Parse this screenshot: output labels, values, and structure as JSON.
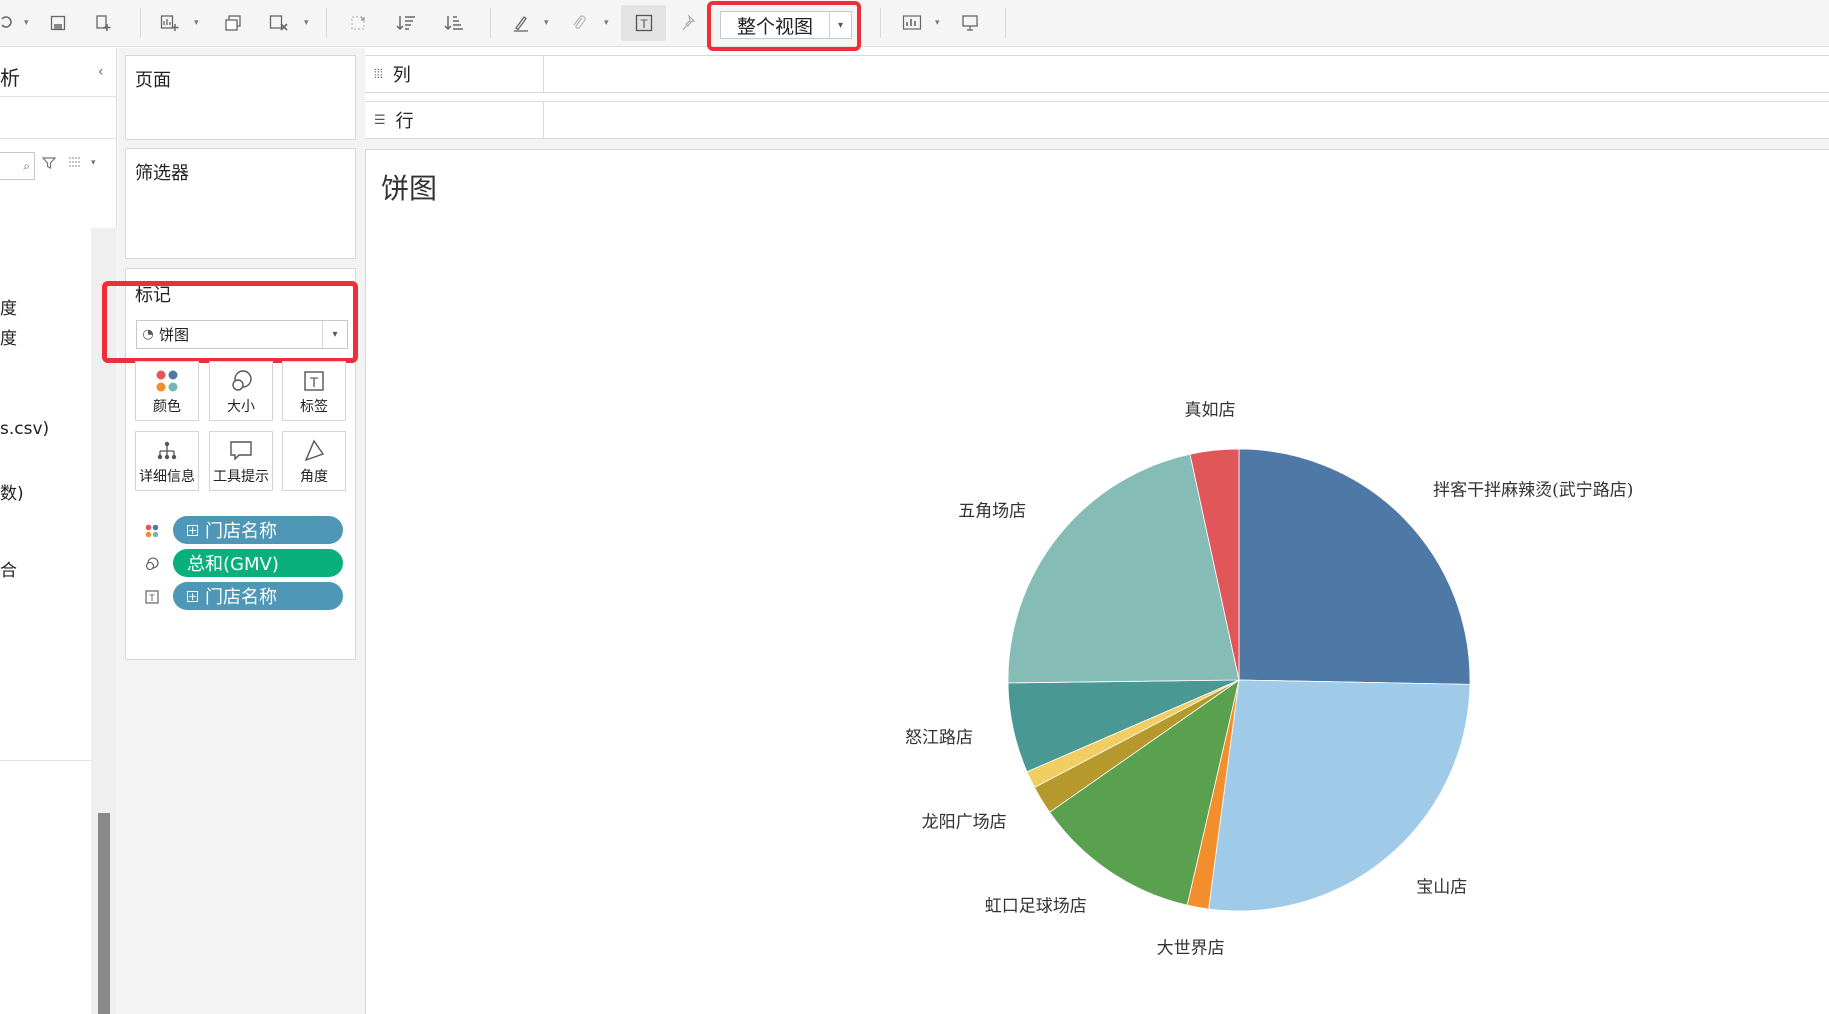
{
  "toolbar": {
    "fit_select_value": "整个视图",
    "icons": [
      "redo-icon",
      "save-icon",
      "new-datasource-icon",
      "new-worksheet-icon",
      "duplicate-sheet-icon",
      "clear-sheet-icon",
      "swap-icon",
      "sort-ascending-icon",
      "sort-descending-icon",
      "highlight-icon",
      "group-icon",
      "show-labels-icon",
      "pin-icon",
      "show-me-icon",
      "presentation-icon"
    ]
  },
  "data_panel": {
    "title_fragment": "析",
    "items": [
      {
        "text": "度"
      },
      {
        "text": "度"
      },
      {
        "text": "s.csv)"
      },
      {
        "text": "数)"
      },
      {
        "text": "合"
      }
    ]
  },
  "pages_card": {
    "title": "页面"
  },
  "filters_card": {
    "title": "筛选器"
  },
  "marks_card": {
    "title": "标记",
    "mark_type": "饼图",
    "buttons": [
      {
        "label": "颜色",
        "icon": "color-dots-icon"
      },
      {
        "label": "大小",
        "icon": "size-icon"
      },
      {
        "label": "标签",
        "icon": "label-text-icon"
      },
      {
        "label": "详细信息",
        "icon": "detail-icon"
      },
      {
        "label": "工具提示",
        "icon": "tooltip-icon"
      },
      {
        "label": "角度",
        "icon": "angle-icon"
      }
    ],
    "pills": [
      {
        "label": "门店名称",
        "encoding": "color"
      },
      {
        "label": "总和(GMV)",
        "encoding": "angle"
      },
      {
        "label": "门店名称",
        "encoding": "label"
      }
    ]
  },
  "columns_shelf": {
    "label": "列"
  },
  "rows_shelf": {
    "label": "行"
  },
  "view": {
    "title": "饼图"
  },
  "chart_data": {
    "type": "pie",
    "title": "饼图",
    "slices": [
      {
        "label": "拌客干拌麻辣烫(武宁路店)",
        "value": 25.3,
        "color": "#4e79a7"
      },
      {
        "label": "宝山店",
        "value": 26.8,
        "color": "#a0cbe8"
      },
      {
        "label": "大世界店",
        "value": 1.5,
        "color": "#f28e2b"
      },
      {
        "label": "虹口足球场店",
        "value": 11.7,
        "color": "#59a14f"
      },
      {
        "label": "龙阳广场店",
        "value": 2.0,
        "color": "#b6992d"
      },
      {
        "label": "",
        "value": 1.2,
        "color": "#f1ce63"
      },
      {
        "label": "怒江路店",
        "value": 6.3,
        "color": "#499894"
      },
      {
        "label": "五角场店",
        "value": 21.8,
        "color": "#86bcb6"
      },
      {
        "label": "真如店",
        "value": 3.4,
        "color": "#e15759"
      }
    ]
  }
}
